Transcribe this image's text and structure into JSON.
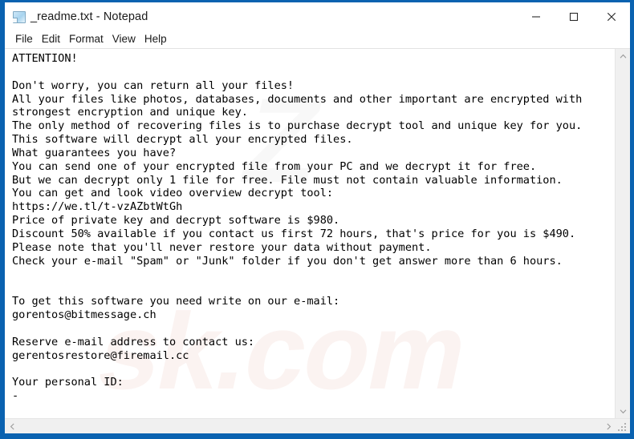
{
  "window": {
    "title": "_readme.txt - Notepad",
    "icon": "notepad-document-icon",
    "frame_color": "#0a62b0",
    "controls": [
      {
        "name": "minimize",
        "glyph": "minimize-icon"
      },
      {
        "name": "maximize",
        "glyph": "maximize-icon"
      },
      {
        "name": "close",
        "glyph": "close-icon"
      }
    ]
  },
  "menu": {
    "items": [
      {
        "label": "File"
      },
      {
        "label": "Edit"
      },
      {
        "label": "Format"
      },
      {
        "label": "View"
      },
      {
        "label": "Help"
      }
    ]
  },
  "document": {
    "filename": "_readme.txt",
    "content": "ATTENTION!\n\nDon't worry, you can return all your files!\nAll your files like photos, databases, documents and other important are encrypted with\nstrongest encryption and unique key.\nThe only method of recovering files is to purchase decrypt tool and unique key for you.\nThis software will decrypt all your encrypted files.\nWhat guarantees you have?\nYou can send one of your encrypted file from your PC and we decrypt it for free.\nBut we can decrypt only 1 file for free. File must not contain valuable information.\nYou can get and look video overview decrypt tool:\nhttps://we.tl/t-vzAZbtWtGh\nPrice of private key and decrypt software is $980.\nDiscount 50% available if you contact us first 72 hours, that's price for you is $490.\nPlease note that you'll never restore your data without payment.\nCheck your e-mail \"Spam\" or \"Junk\" folder if you don't get answer more than 6 hours.\n\n\nTo get this software you need write on our e-mail:\ngorentos@bitmessage.ch\n\nReserve e-mail address to contact us:\ngerentosrestore@firemail.cc\n\nYour personal ID:\n-",
    "details": {
      "heading": "ATTENTION!",
      "video_url": "https://we.tl/t-vzAZbtWtGh",
      "price": "$980",
      "discount_price": "$490",
      "discount_percent": "50%",
      "discount_window_hours": "72 hours",
      "response_window_hours": "6 hours",
      "free_files": "1 file",
      "primary_email": "gorentos@bitmessage.ch",
      "reserve_email": "gerentosrestore@firemail.cc",
      "personal_id": "-"
    }
  },
  "scrollbars": {
    "vertical": {
      "up_arrow": "chevron-up-icon",
      "down_arrow": "chevron-down-icon"
    },
    "horizontal": {
      "left_arrow": "chevron-left-icon",
      "right_arrow": "chevron-right-icon"
    },
    "resize_grip": "resize-grip-icon"
  },
  "watermarks": {
    "grey": "Z",
    "pink": "sk.com"
  }
}
